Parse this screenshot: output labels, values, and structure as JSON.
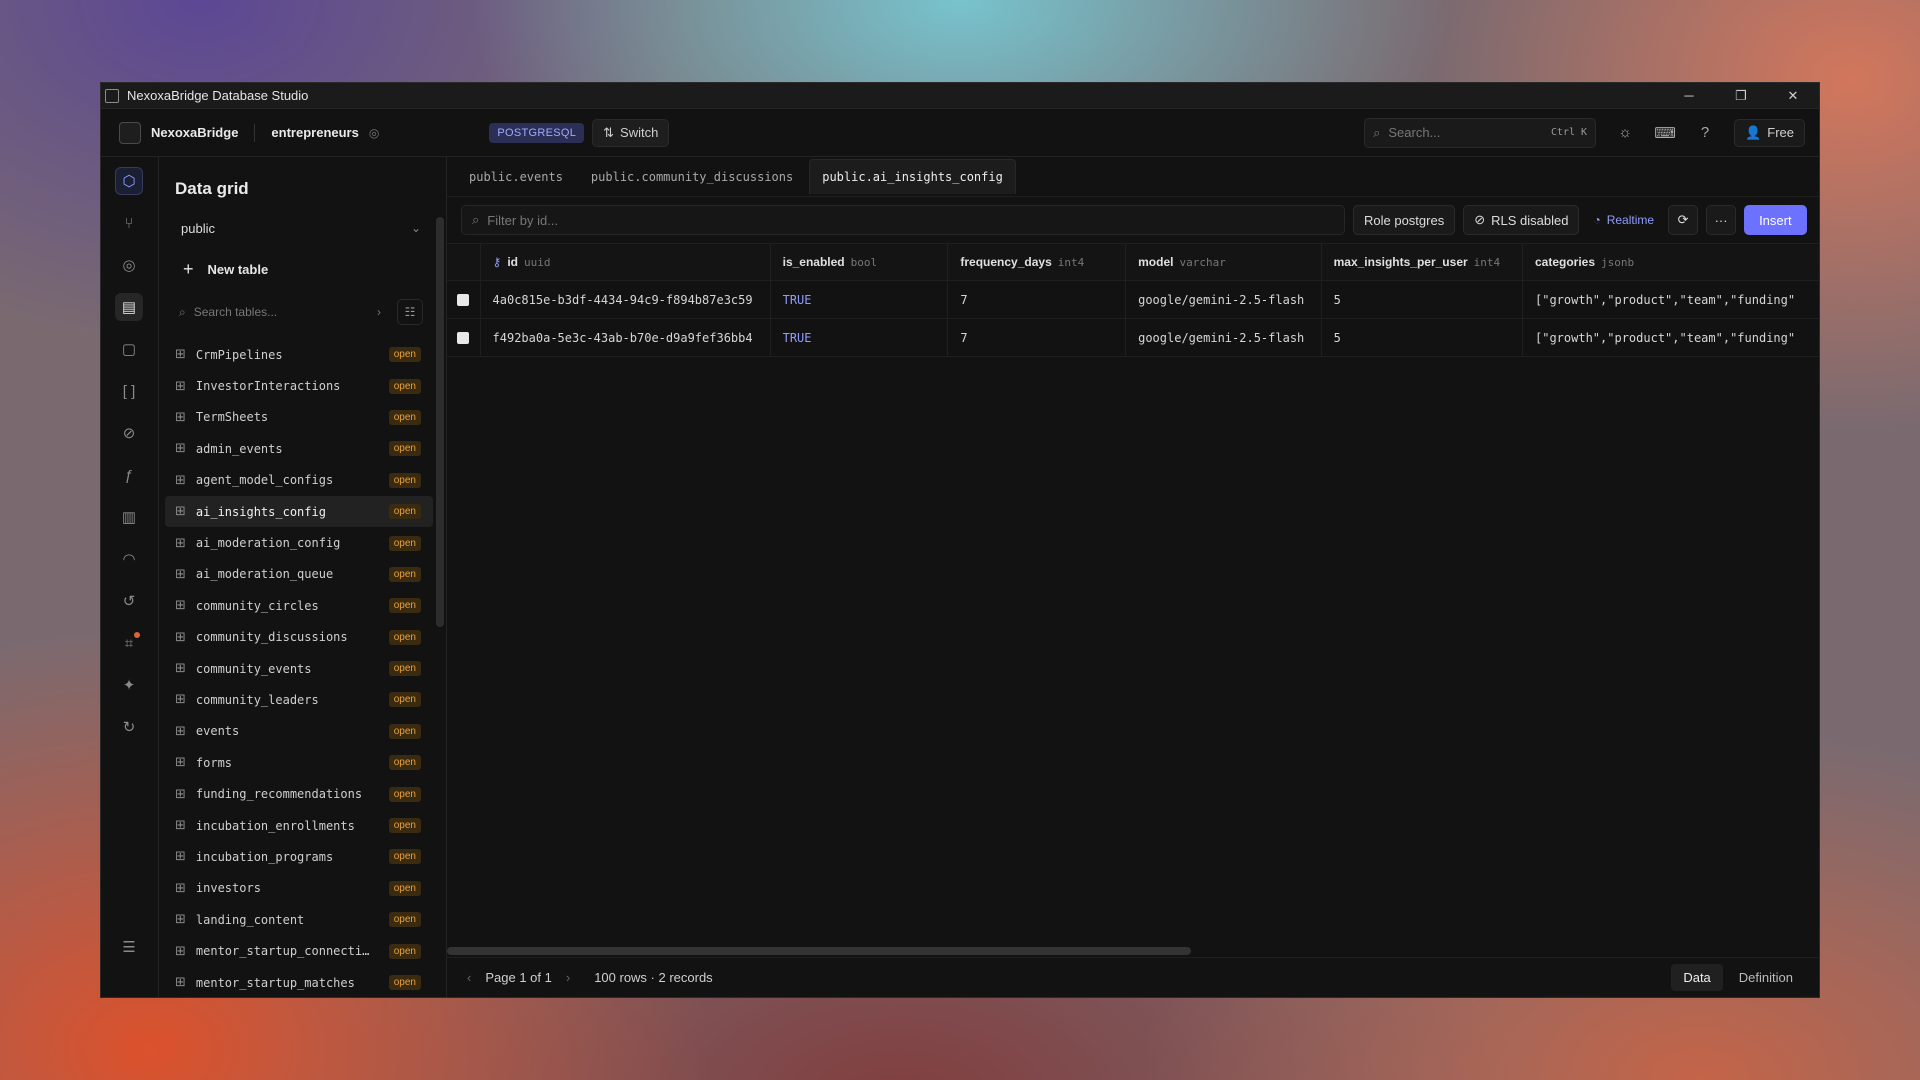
{
  "window": {
    "title": "NexoxaBridge Database Studio",
    "controls": [
      "─",
      "❐",
      "✕"
    ]
  },
  "topbar": {
    "org_name": "NexoxaBridge",
    "project_name": "entrepreneurs",
    "db_badge": "POSTGRESQL",
    "switch_label": "Switch",
    "search_placeholder": "Search...",
    "search_shortcut": "Ctrl K",
    "plan_label": "Free"
  },
  "sidebar": {
    "title": "Data grid",
    "schema": "public",
    "new_table_label": "New table",
    "search_placeholder": "Search tables...",
    "tables": [
      {
        "name": "CrmPipelines",
        "badge": "open",
        "active": false
      },
      {
        "name": "InvestorInteractions",
        "badge": "open",
        "active": false
      },
      {
        "name": "TermSheets",
        "badge": "open",
        "active": false
      },
      {
        "name": "admin_events",
        "badge": "open",
        "active": false
      },
      {
        "name": "agent_model_configs",
        "badge": "open",
        "active": false
      },
      {
        "name": "ai_insights_config",
        "badge": "open",
        "active": true
      },
      {
        "name": "ai_moderation_config",
        "badge": "open",
        "active": false
      },
      {
        "name": "ai_moderation_queue",
        "badge": "open",
        "active": false
      },
      {
        "name": "community_circles",
        "badge": "open",
        "active": false
      },
      {
        "name": "community_discussions",
        "badge": "open",
        "active": false
      },
      {
        "name": "community_events",
        "badge": "open",
        "active": false
      },
      {
        "name": "community_leaders",
        "badge": "open",
        "active": false
      },
      {
        "name": "events",
        "badge": "open",
        "active": false
      },
      {
        "name": "forms",
        "badge": "open",
        "active": false
      },
      {
        "name": "funding_recommendations",
        "badge": "open",
        "active": false
      },
      {
        "name": "incubation_enrollments",
        "badge": "open",
        "active": false
      },
      {
        "name": "incubation_programs",
        "badge": "open",
        "active": false
      },
      {
        "name": "investors",
        "badge": "open",
        "active": false
      },
      {
        "name": "landing_content",
        "badge": "open",
        "active": false
      },
      {
        "name": "mentor_startup_connecti…",
        "badge": "open",
        "active": false
      },
      {
        "name": "mentor_startup_matches",
        "badge": "open",
        "active": false
      }
    ]
  },
  "tabs": [
    {
      "label": "public.events",
      "active": false
    },
    {
      "label": "public.community_discussions",
      "active": false
    },
    {
      "label": "public.ai_insights_config",
      "active": true
    }
  ],
  "toolbar": {
    "filter_placeholder": "Filter by id...",
    "role_label": "Role postgres",
    "rls_label": "RLS disabled",
    "realtime_label": "Realtime",
    "insert_label": "Insert"
  },
  "grid": {
    "columns": [
      {
        "name": "id",
        "type": "uuid"
      },
      {
        "name": "is_enabled",
        "type": "bool"
      },
      {
        "name": "frequency_days",
        "type": "int4"
      },
      {
        "name": "model",
        "type": "varchar"
      },
      {
        "name": "max_insights_per_user",
        "type": "int4"
      },
      {
        "name": "categories",
        "type": "jsonb"
      }
    ],
    "rows": [
      [
        "4a0c815e-b3df-4434-94c9-f894b87e3c59",
        "TRUE",
        "7",
        "google/gemini-2.5-flash",
        "5",
        "[\"growth\",\"product\",\"team\",\"funding\""
      ],
      [
        "f492ba0a-5e3c-43ab-b70e-d9a9fef36bb4",
        "TRUE",
        "7",
        "google/gemini-2.5-flash",
        "5",
        "[\"growth\",\"product\",\"team\",\"funding\""
      ]
    ]
  },
  "status": {
    "page_label": "Page 1 of 1",
    "rows_label": "100 rows · 2 records",
    "data_label": "Data",
    "definition_label": "Definition"
  },
  "colors": {
    "accent": "#6d71ff",
    "badge_text": "#e9a13a",
    "background": "#121212"
  }
}
